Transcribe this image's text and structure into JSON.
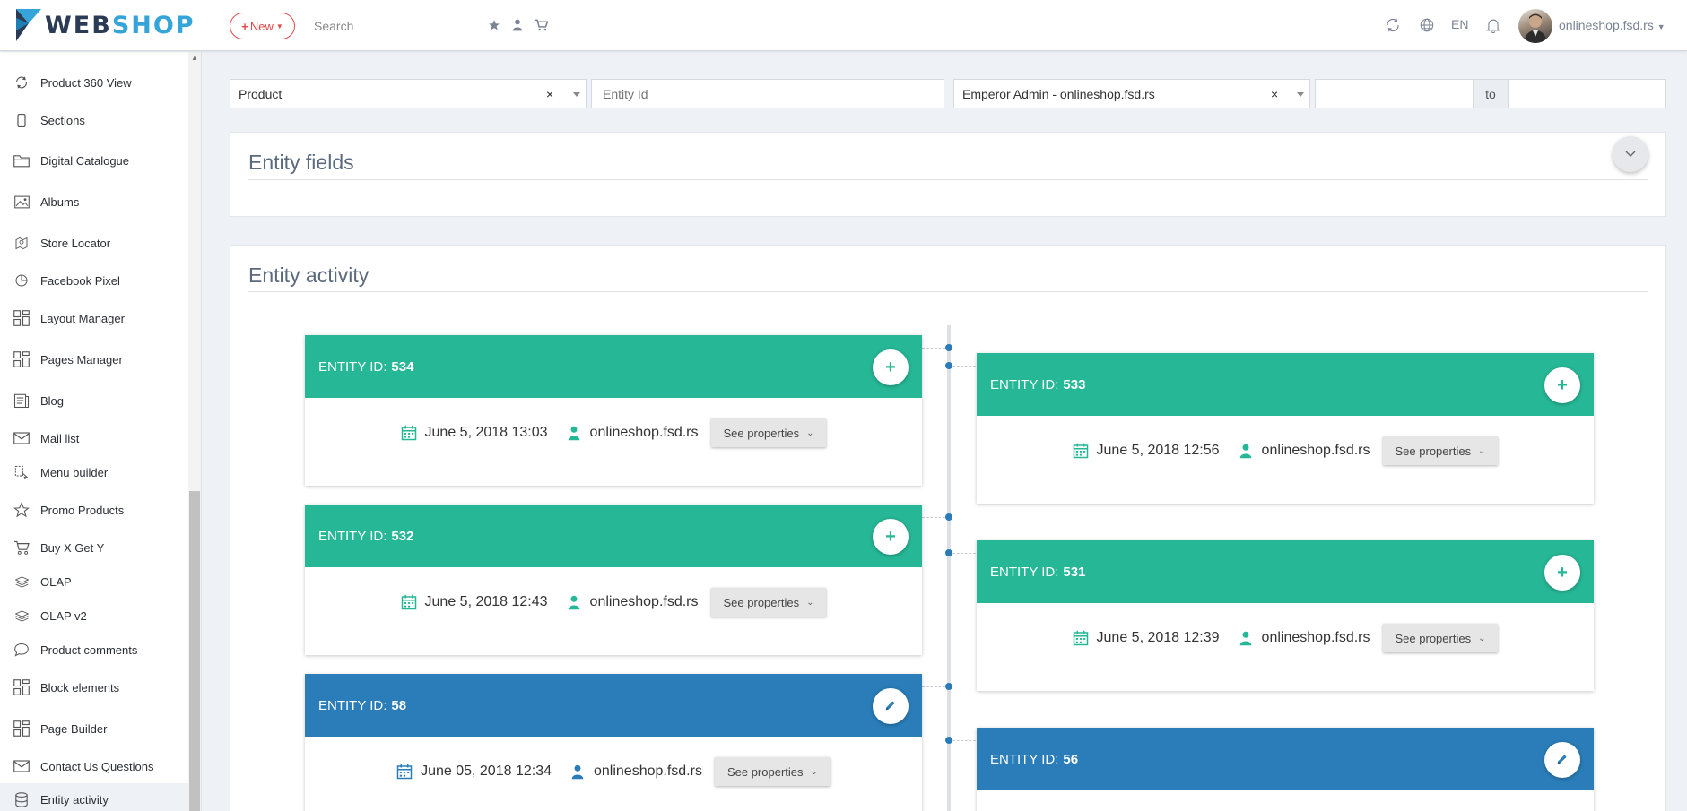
{
  "header": {
    "logo_web": "WEB",
    "logo_shop": "SHOP",
    "new_label": "New",
    "search_placeholder": "Search",
    "lang": "EN",
    "user": "onlineshop.fsd.rs"
  },
  "sidebar": {
    "items": [
      {
        "label": "Product 360 View",
        "icon": "refresh-icon"
      },
      {
        "label": "Sections",
        "icon": "mobile-icon"
      },
      {
        "label": "Digital Catalogue",
        "icon": "folder-icon"
      },
      {
        "label": "Albums",
        "icon": "image-icon"
      },
      {
        "label": "Store Locator",
        "icon": "map-pin-icon"
      },
      {
        "label": "Facebook Pixel",
        "icon": "pie-chart-icon"
      },
      {
        "label": "Layout Manager",
        "icon": "layout-icon"
      },
      {
        "label": "Pages Manager",
        "icon": "layout-icon"
      },
      {
        "label": "Blog",
        "icon": "blog-icon"
      },
      {
        "label": "Mail list",
        "icon": "envelope-icon"
      },
      {
        "label": "Menu builder",
        "icon": "menu-builder-icon"
      },
      {
        "label": "Promo Products",
        "icon": "star-icon"
      },
      {
        "label": "Buy X Get Y",
        "icon": "cart-icon"
      },
      {
        "label": "OLAP",
        "icon": "layers-icon"
      },
      {
        "label": "OLAP v2",
        "icon": "layers-icon"
      },
      {
        "label": "Product comments",
        "icon": "comment-icon"
      },
      {
        "label": "Block elements",
        "icon": "layout-icon"
      },
      {
        "label": "Page Builder",
        "icon": "layout-icon"
      },
      {
        "label": "Contact Us Questions",
        "icon": "envelope-icon"
      },
      {
        "label": "Entity activity",
        "icon": "database-icon"
      }
    ]
  },
  "filters": {
    "entity_type": "Product",
    "entity_id_placeholder": "Entity Id",
    "user": "Emperor Admin - onlineshop.fsd.rs",
    "to_label": "to"
  },
  "entity_fields": {
    "title": "Entity fields"
  },
  "entity_activity": {
    "title": "Entity activity",
    "id_label": "ENTITY ID:",
    "props_label": "See properties",
    "entries": [
      {
        "id": "534",
        "date": "June 5, 2018 13:03",
        "user": "onlineshop.fsd.rs",
        "action": "create",
        "color": "#26b796"
      },
      {
        "id": "533",
        "date": "June 5, 2018 12:56",
        "user": "onlineshop.fsd.rs",
        "action": "create",
        "color": "#26b796"
      },
      {
        "id": "532",
        "date": "June 5, 2018 12:43",
        "user": "onlineshop.fsd.rs",
        "action": "create",
        "color": "#26b796"
      },
      {
        "id": "531",
        "date": "June 5, 2018 12:39",
        "user": "onlineshop.fsd.rs",
        "action": "create",
        "color": "#26b796"
      },
      {
        "id": "58",
        "date": "June 05, 2018 12:34",
        "user": "onlineshop.fsd.rs",
        "action": "edit",
        "color": "#2a7db8"
      },
      {
        "id": "56",
        "date": "",
        "user": "",
        "action": "edit",
        "color": "#2a7db8"
      }
    ]
  }
}
